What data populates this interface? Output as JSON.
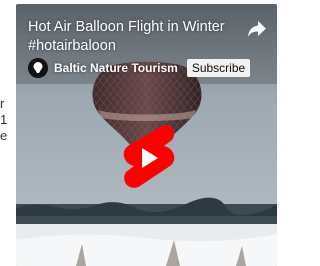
{
  "side": {
    "lines": [
      "r",
      "1",
      "e"
    ]
  },
  "video": {
    "title": "Hot Air Balloon Flight in Winter #hotairbaloon",
    "channel": "Baltic Nature Tourism",
    "subscribe_label": "Subscribe",
    "share_icon": "share-icon",
    "play_icon": "youtube-shorts-play-icon"
  },
  "colors": {
    "shorts_red": "#ff0000",
    "overlay_text": "#ffffff",
    "sky": "#a4adb5",
    "snow": "#eef0f2"
  }
}
